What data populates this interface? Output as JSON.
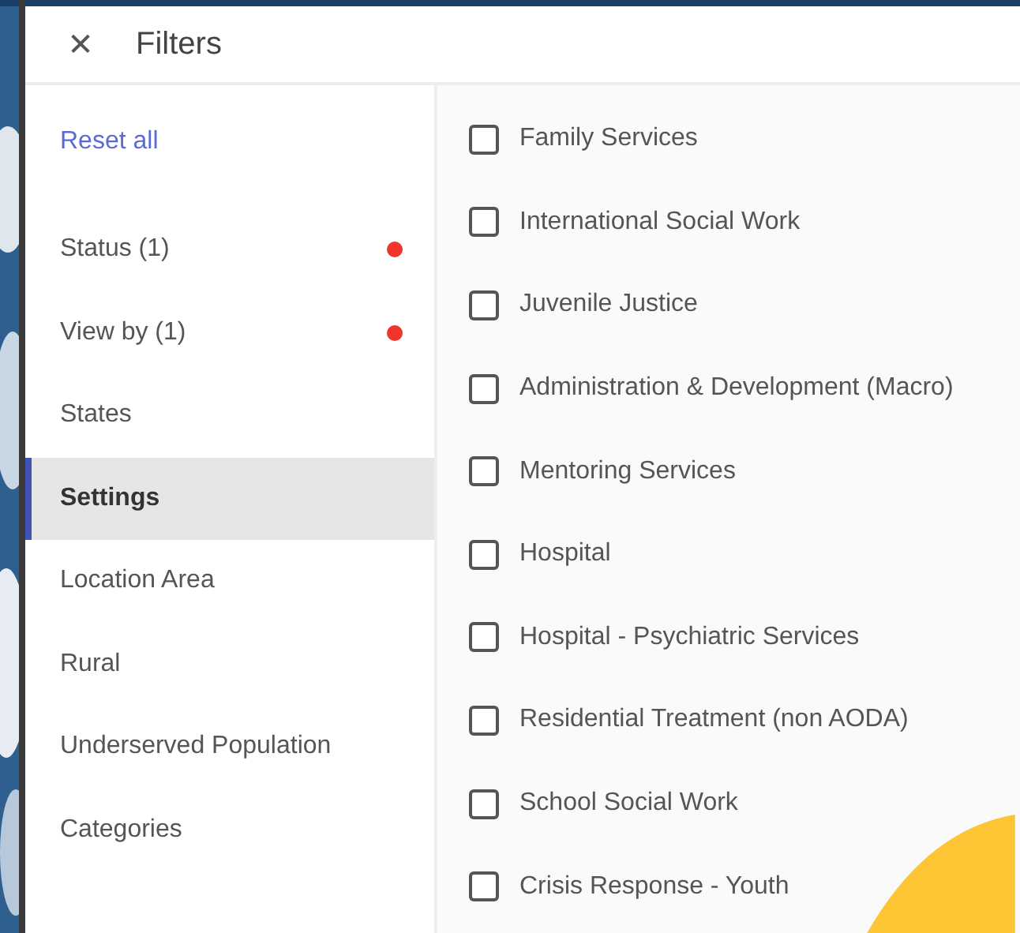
{
  "header": {
    "close": "✕",
    "title": "Filters"
  },
  "sidebar": {
    "reset": "Reset all",
    "items": [
      {
        "label": "Status (1)",
        "selected": false,
        "active": true
      },
      {
        "label": "View by (1)",
        "selected": false,
        "active": true
      },
      {
        "label": "States",
        "selected": false,
        "active": false
      },
      {
        "label": "Settings",
        "selected": true,
        "active": false
      },
      {
        "label": "Location Area",
        "selected": false,
        "active": false
      },
      {
        "label": "Rural",
        "selected": false,
        "active": false
      },
      {
        "label": "Underserved Population",
        "selected": false,
        "active": false
      },
      {
        "label": "Categories",
        "selected": false,
        "active": false
      }
    ]
  },
  "options": [
    {
      "label": "Family Services",
      "checked": false
    },
    {
      "label": "International Social Work",
      "checked": false
    },
    {
      "label": "Juvenile Justice",
      "checked": false
    },
    {
      "label": "Administration & Development (Macro)",
      "checked": false
    },
    {
      "label": "Mentoring Services",
      "checked": false
    },
    {
      "label": "Hospital",
      "checked": false
    },
    {
      "label": "Hospital - Psychiatric Services",
      "checked": false
    },
    {
      "label": "Residential Treatment (non AODA)",
      "checked": false
    },
    {
      "label": "School Social Work",
      "checked": false
    },
    {
      "label": "Crisis Response - Youth",
      "checked": false
    }
  ]
}
